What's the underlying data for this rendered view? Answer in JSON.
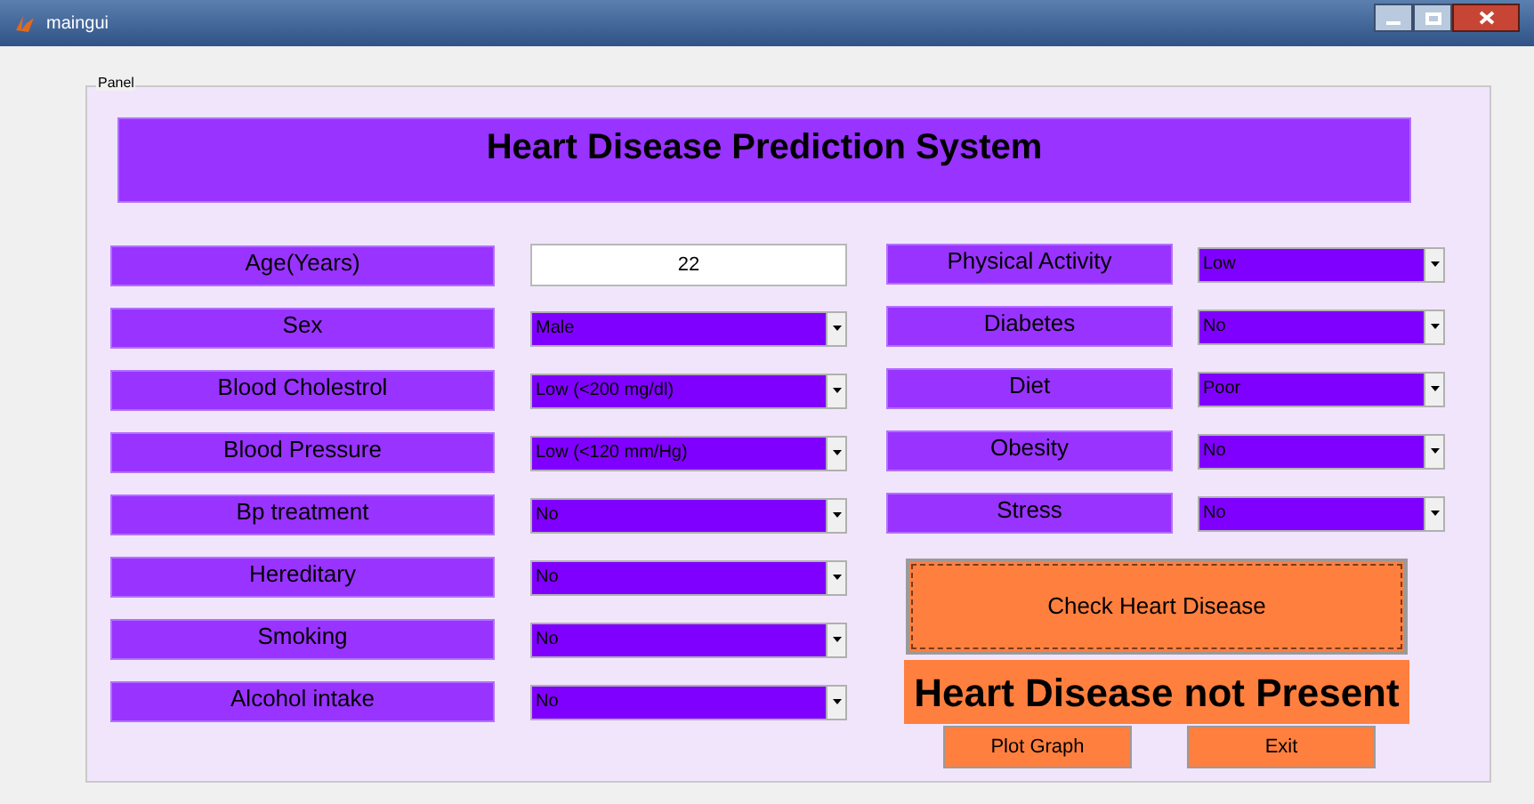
{
  "window": {
    "title": "maingui"
  },
  "panel": {
    "title": "Panel"
  },
  "header": "Heart Disease Prediction System",
  "left_fields": [
    {
      "label": "Age(Years)",
      "kind": "edit",
      "value": "22"
    },
    {
      "label": "Sex",
      "kind": "popup",
      "value": "Male"
    },
    {
      "label": "Blood Cholestrol",
      "kind": "popup",
      "value": "Low (<200 mg/dl)"
    },
    {
      "label": "Blood Pressure",
      "kind": "popup",
      "value": "Low (<120 mm/Hg)"
    },
    {
      "label": "Bp treatment",
      "kind": "popup",
      "value": "No"
    },
    {
      "label": "Hereditary",
      "kind": "popup",
      "value": "No"
    },
    {
      "label": "Smoking",
      "kind": "popup",
      "value": "No"
    },
    {
      "label": "Alcohol intake",
      "kind": "popup",
      "value": "No"
    }
  ],
  "right_fields": [
    {
      "label": "Physical Activity",
      "kind": "popup",
      "value": "Low"
    },
    {
      "label": "Diabetes",
      "kind": "popup",
      "value": "No"
    },
    {
      "label": "Diet",
      "kind": "popup",
      "value": "Poor"
    },
    {
      "label": "Obesity",
      "kind": "popup",
      "value": "No"
    },
    {
      "label": "Stress",
      "kind": "popup",
      "value": "No"
    }
  ],
  "check_button": "Check Heart Disease",
  "result": "Heart Disease not Present",
  "buttons": [
    "Plot Graph",
    "Exit"
  ]
}
